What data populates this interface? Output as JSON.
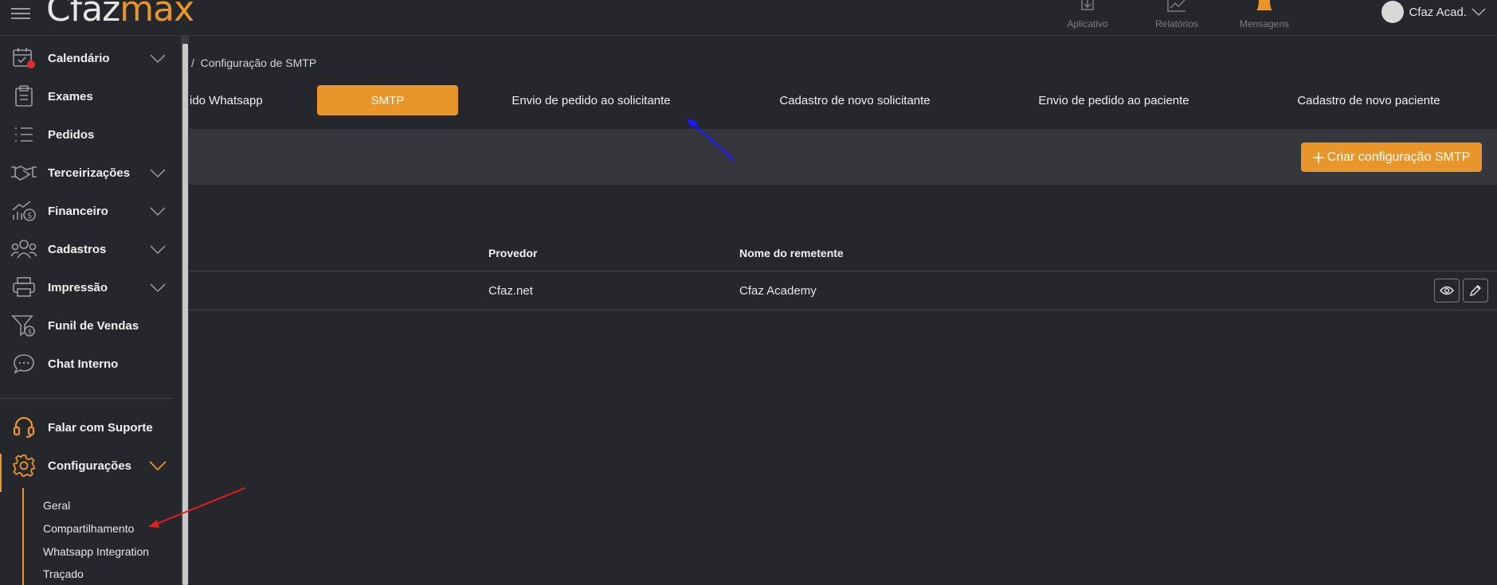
{
  "topbar": {
    "logo_part1": "Cfaz",
    "logo_part2": "max",
    "nav": [
      {
        "label": "Aplicativo",
        "icon": "download-icon"
      },
      {
        "label": "Relatórios",
        "icon": "chart-line-icon"
      },
      {
        "label": "Mensagens",
        "icon": "bell-icon"
      }
    ],
    "user_name": "Cfaz Acad."
  },
  "sidebar": {
    "items": [
      {
        "label": "Calendário",
        "icon": "calendar-icon",
        "expandable": true
      },
      {
        "label": "Exames",
        "icon": "clipboard-icon",
        "expandable": false
      },
      {
        "label": "Pedidos",
        "icon": "list-icon",
        "expandable": false
      },
      {
        "label": "Terceirizações",
        "icon": "handshake-icon",
        "expandable": true
      },
      {
        "label": "Financeiro",
        "icon": "finance-icon",
        "expandable": true
      },
      {
        "label": "Cadastros",
        "icon": "users-icon",
        "expandable": true
      },
      {
        "label": "Impressão",
        "icon": "printer-icon",
        "expandable": true
      },
      {
        "label": "Funil de Vendas",
        "icon": "funnel-icon",
        "expandable": false
      },
      {
        "label": "Chat Interno",
        "icon": "chat-icon",
        "expandable": false
      }
    ],
    "support_label": "Falar com Suporte",
    "settings_label": "Configurações",
    "settings_sub": [
      "Geral",
      "Compartilhamento",
      "Whatsapp Integration",
      "Traçado"
    ]
  },
  "breadcrumb": {
    "separator": "/",
    "current": "Configuração de SMTP"
  },
  "tabs": [
    {
      "label": "ido Whatsapp",
      "active": false
    },
    {
      "label": "SMTP",
      "active": true
    },
    {
      "label": "Envio de pedido ao solicitante",
      "active": false
    },
    {
      "label": "Cadastro de novo solicitante",
      "active": false
    },
    {
      "label": "Envio de pedido ao paciente",
      "active": false
    },
    {
      "label": "Cadastro de novo paciente",
      "active": false
    }
  ],
  "toolbar": {
    "create_label": "Criar configuração SMTP"
  },
  "table": {
    "headers": [
      "Provedor",
      "Nome do remetente"
    ],
    "rows": [
      {
        "provedor": "Cfaz.net",
        "remetente": "Cfaz Academy"
      }
    ]
  },
  "colors": {
    "accent": "#e8952a",
    "background": "#25272c",
    "panel": "#35373d",
    "annotation_blue": "#1a1aff",
    "annotation_red": "#e02020"
  }
}
